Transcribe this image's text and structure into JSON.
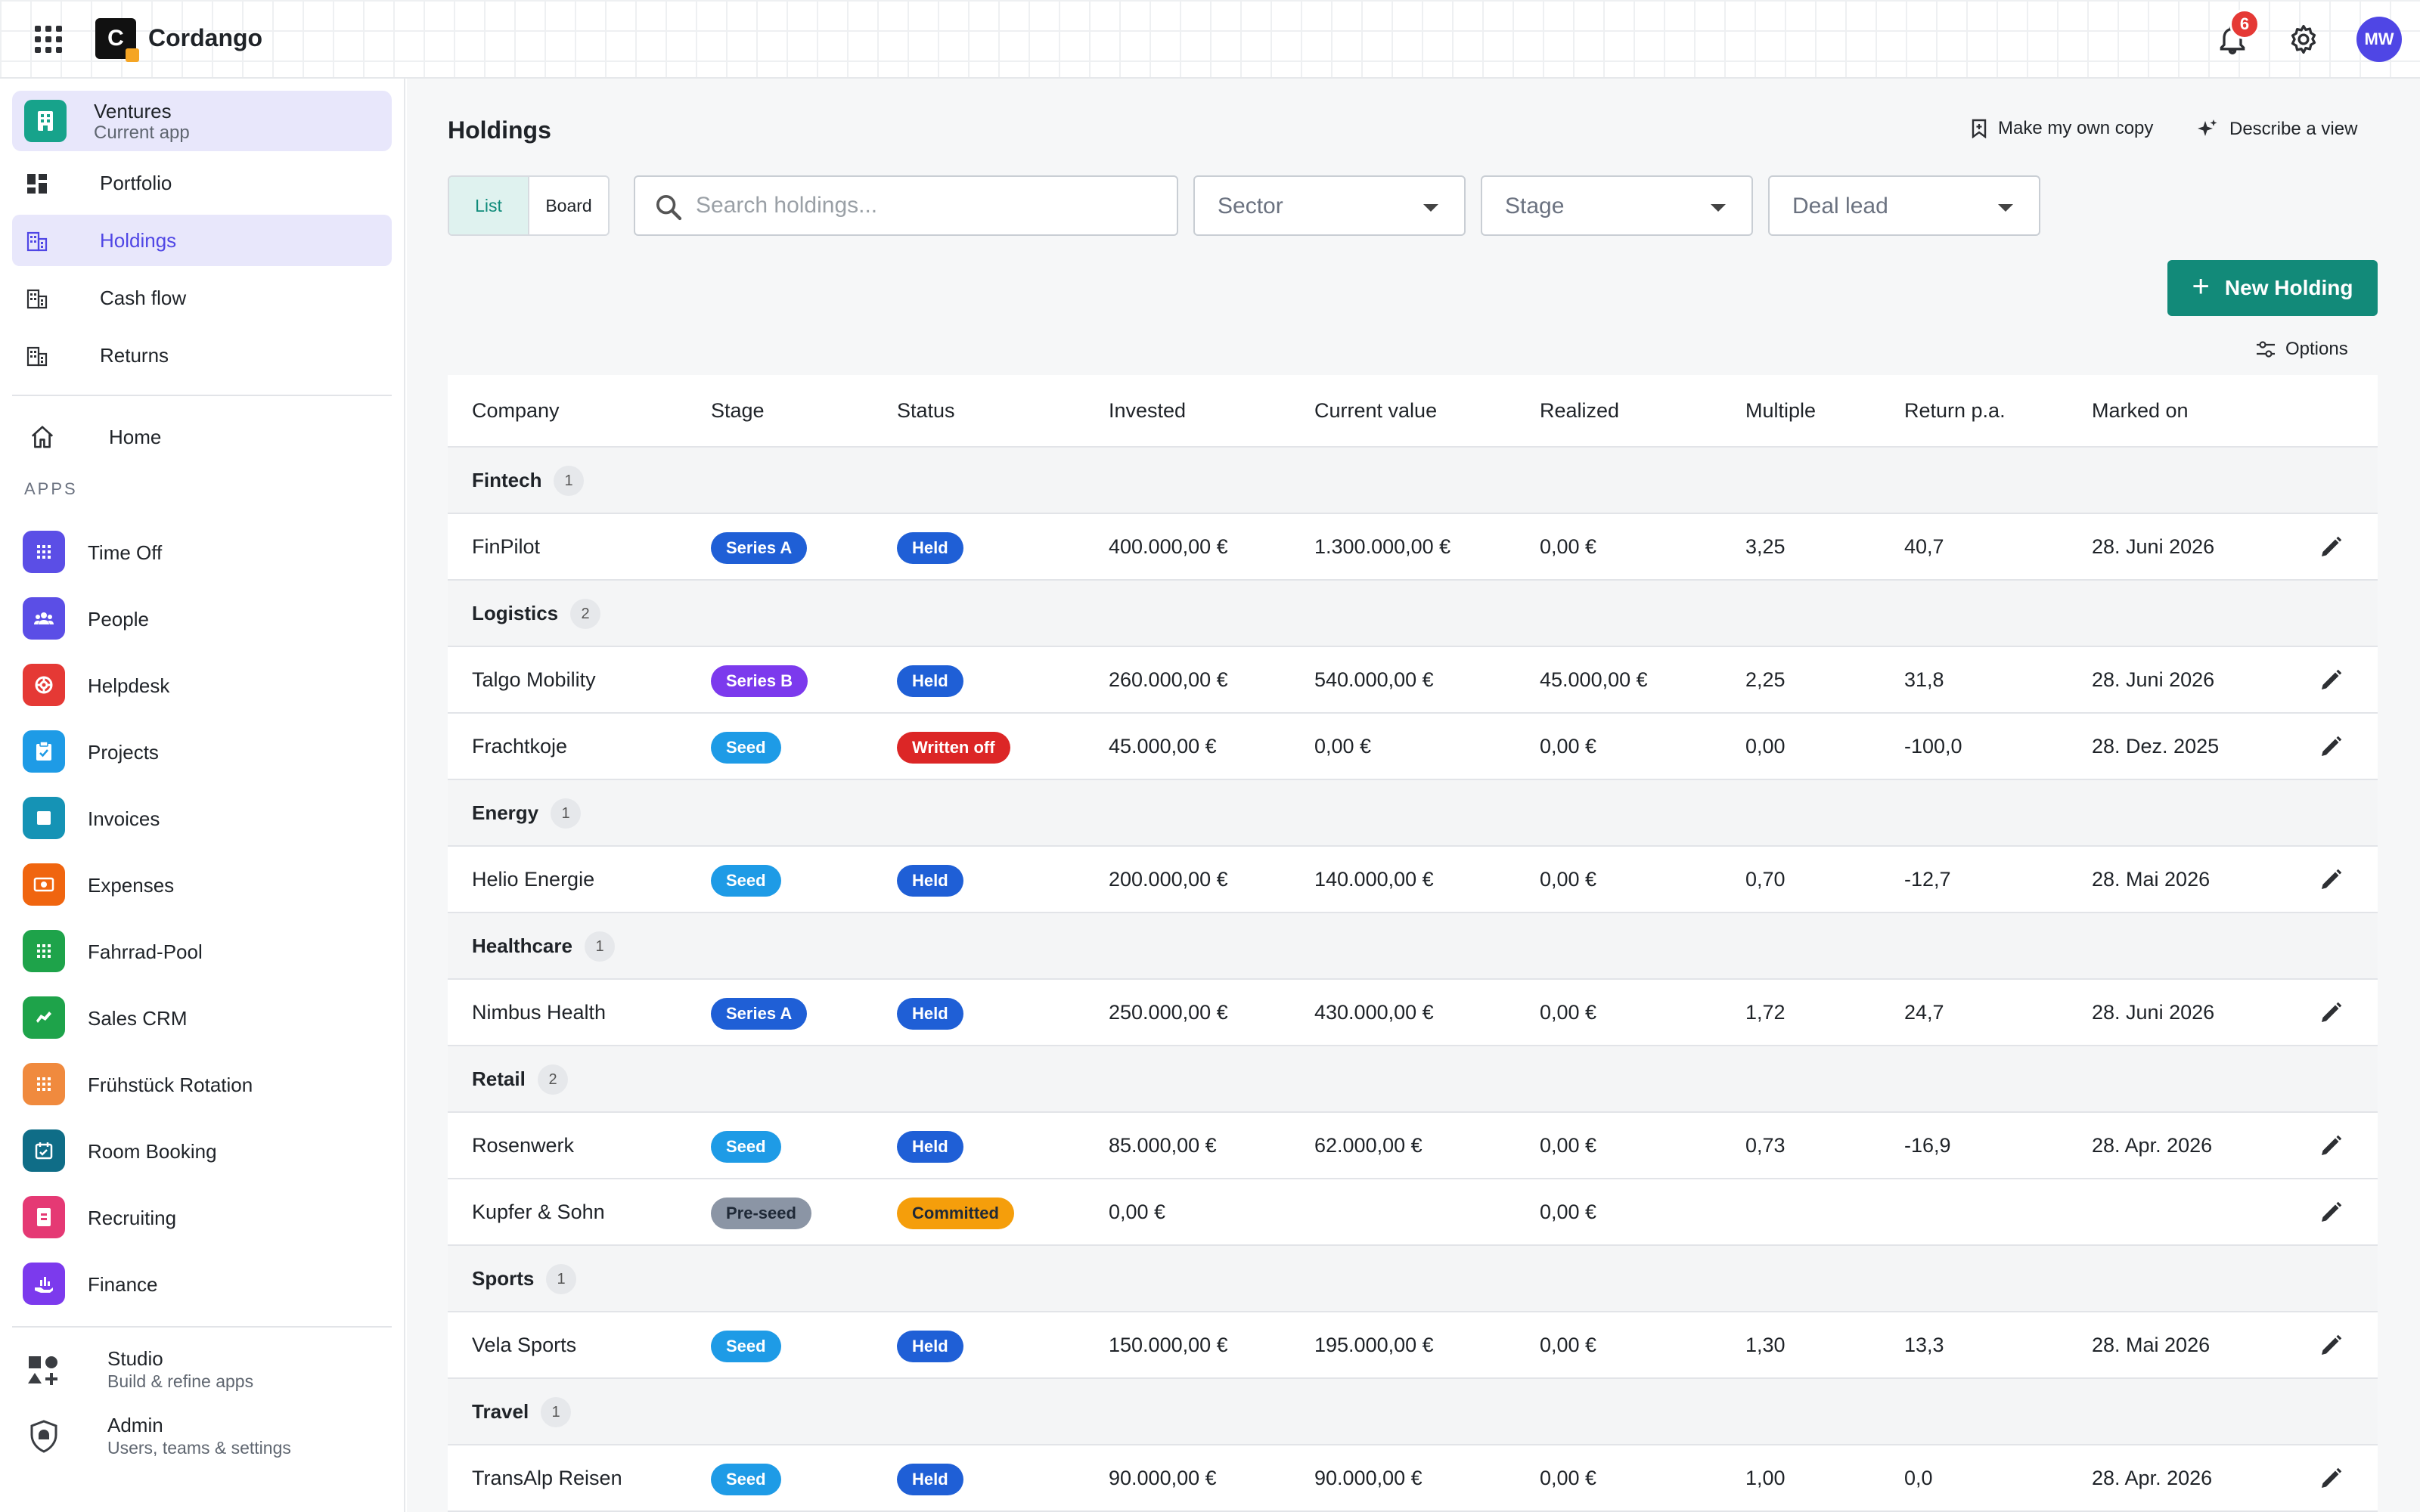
{
  "topbar": {
    "brand": "Cordango",
    "logo_letter": "C",
    "notifications_count": "6",
    "avatar_initials": "MW"
  },
  "sidebar": {
    "current_app": {
      "name": "Ventures",
      "subtitle": "Current app"
    },
    "nav": [
      {
        "label": "Portfolio",
        "icon": "dashboard-icon"
      },
      {
        "label": "Holdings",
        "icon": "building-icon",
        "active": true
      },
      {
        "label": "Cash flow",
        "icon": "building-icon"
      },
      {
        "label": "Returns",
        "icon": "building-icon"
      }
    ],
    "home_label": "Home",
    "apps_heading": "APPS",
    "apps": [
      {
        "label": "Time Off",
        "color": "#5b4ee6"
      },
      {
        "label": "People",
        "color": "#5b4ee6"
      },
      {
        "label": "Helpdesk",
        "color": "#e53935"
      },
      {
        "label": "Projects",
        "color": "#1e9be6"
      },
      {
        "label": "Invoices",
        "color": "#1593b5"
      },
      {
        "label": "Expenses",
        "color": "#f0650f"
      },
      {
        "label": "Fahrrad-Pool",
        "color": "#1ea34a"
      },
      {
        "label": "Sales CRM",
        "color": "#1ea34a"
      },
      {
        "label": "Frühstück Rotation",
        "color": "#f08a3e"
      },
      {
        "label": "Room Booking",
        "color": "#0f6d87"
      },
      {
        "label": "Recruiting",
        "color": "#e53974"
      },
      {
        "label": "Finance",
        "color": "#7c3aed"
      }
    ],
    "footer": [
      {
        "title": "Studio",
        "subtitle": "Build & refine apps"
      },
      {
        "title": "Admin",
        "subtitle": "Users, teams & settings"
      }
    ]
  },
  "main": {
    "title": "Holdings",
    "make_copy_label": "Make my own copy",
    "describe_view_label": "Describe a view",
    "view_toggle": {
      "list": "List",
      "board": "Board"
    },
    "search_placeholder": "Search holdings...",
    "filters": {
      "sector": "Sector",
      "stage": "Stage",
      "deal_lead": "Deal lead"
    },
    "new_button_label": "New Holding",
    "options_label": "Options",
    "columns": [
      "Company",
      "Stage",
      "Status",
      "Invested",
      "Current value",
      "Realized",
      "Multiple",
      "Return p.a.",
      "Marked on"
    ]
  },
  "groups": [
    {
      "name": "Fintech",
      "count": "1",
      "rows": [
        {
          "company": "FinPilot",
          "stage": "Series A",
          "stage_color": "#1f5fd6",
          "status": "Held",
          "status_color": "#1f5fd6",
          "invested": "400.000,00 €",
          "current": "1.300.000,00 €",
          "realized": "0,00 €",
          "multiple": "3,25",
          "return": "40,7",
          "marked": "28. Juni 2026"
        }
      ]
    },
    {
      "name": "Logistics",
      "count": "2",
      "rows": [
        {
          "company": "Talgo Mobility",
          "stage": "Series B",
          "stage_color": "#7c3aed",
          "status": "Held",
          "status_color": "#1f5fd6",
          "invested": "260.000,00 €",
          "current": "540.000,00 €",
          "realized": "45.000,00 €",
          "multiple": "2,25",
          "return": "31,8",
          "marked": "28. Juni 2026"
        },
        {
          "company": "Frachtkoje",
          "stage": "Seed",
          "stage_color": "#1e9be6",
          "status": "Written off",
          "status_color": "#dc2626",
          "invested": "45.000,00 €",
          "current": "0,00 €",
          "realized": "0,00 €",
          "multiple": "0,00",
          "return": "-100,0",
          "marked": "28. Dez. 2025"
        }
      ]
    },
    {
      "name": "Energy",
      "count": "1",
      "rows": [
        {
          "company": "Helio Energie",
          "stage": "Seed",
          "stage_color": "#1e9be6",
          "status": "Held",
          "status_color": "#1f5fd6",
          "invested": "200.000,00 €",
          "current": "140.000,00 €",
          "realized": "0,00 €",
          "multiple": "0,70",
          "return": "-12,7",
          "marked": "28. Mai 2026"
        }
      ]
    },
    {
      "name": "Healthcare",
      "count": "1",
      "rows": [
        {
          "company": "Nimbus Health",
          "stage": "Series A",
          "stage_color": "#1f5fd6",
          "status": "Held",
          "status_color": "#1f5fd6",
          "invested": "250.000,00 €",
          "current": "430.000,00 €",
          "realized": "0,00 €",
          "multiple": "1,72",
          "return": "24,7",
          "marked": "28. Juni 2026"
        }
      ]
    },
    {
      "name": "Retail",
      "count": "2",
      "rows": [
        {
          "company": "Rosenwerk",
          "stage": "Seed",
          "stage_color": "#1e9be6",
          "status": "Held",
          "status_color": "#1f5fd6",
          "invested": "85.000,00 €",
          "current": "62.000,00 €",
          "realized": "0,00 €",
          "multiple": "0,73",
          "return": "-16,9",
          "marked": "28. Apr. 2026"
        },
        {
          "company": "Kupfer & Sohn",
          "stage": "Pre-seed",
          "stage_color": "#8b95a5",
          "stage_text_color": "#1f2937",
          "status": "Committed",
          "status_color": "#f59e0b",
          "status_text_color": "#1f2937",
          "invested": "0,00 €",
          "current": "",
          "realized": "0,00 €",
          "multiple": "",
          "return": "",
          "marked": ""
        }
      ]
    },
    {
      "name": "Sports",
      "count": "1",
      "rows": [
        {
          "company": "Vela Sports",
          "stage": "Seed",
          "stage_color": "#1e9be6",
          "status": "Held",
          "status_color": "#1f5fd6",
          "invested": "150.000,00 €",
          "current": "195.000,00 €",
          "realized": "0,00 €",
          "multiple": "1,30",
          "return": "13,3",
          "marked": "28. Mai 2026"
        }
      ]
    },
    {
      "name": "Travel",
      "count": "1",
      "rows": [
        {
          "company": "TransAlp Reisen",
          "stage": "Seed",
          "stage_color": "#1e9be6",
          "status": "Held",
          "status_color": "#1f5fd6",
          "invested": "90.000,00 €",
          "current": "90.000,00 €",
          "realized": "0,00 €",
          "multiple": "1,00",
          "return": "0,0",
          "marked": "28. Apr. 2026"
        }
      ]
    }
  ]
}
